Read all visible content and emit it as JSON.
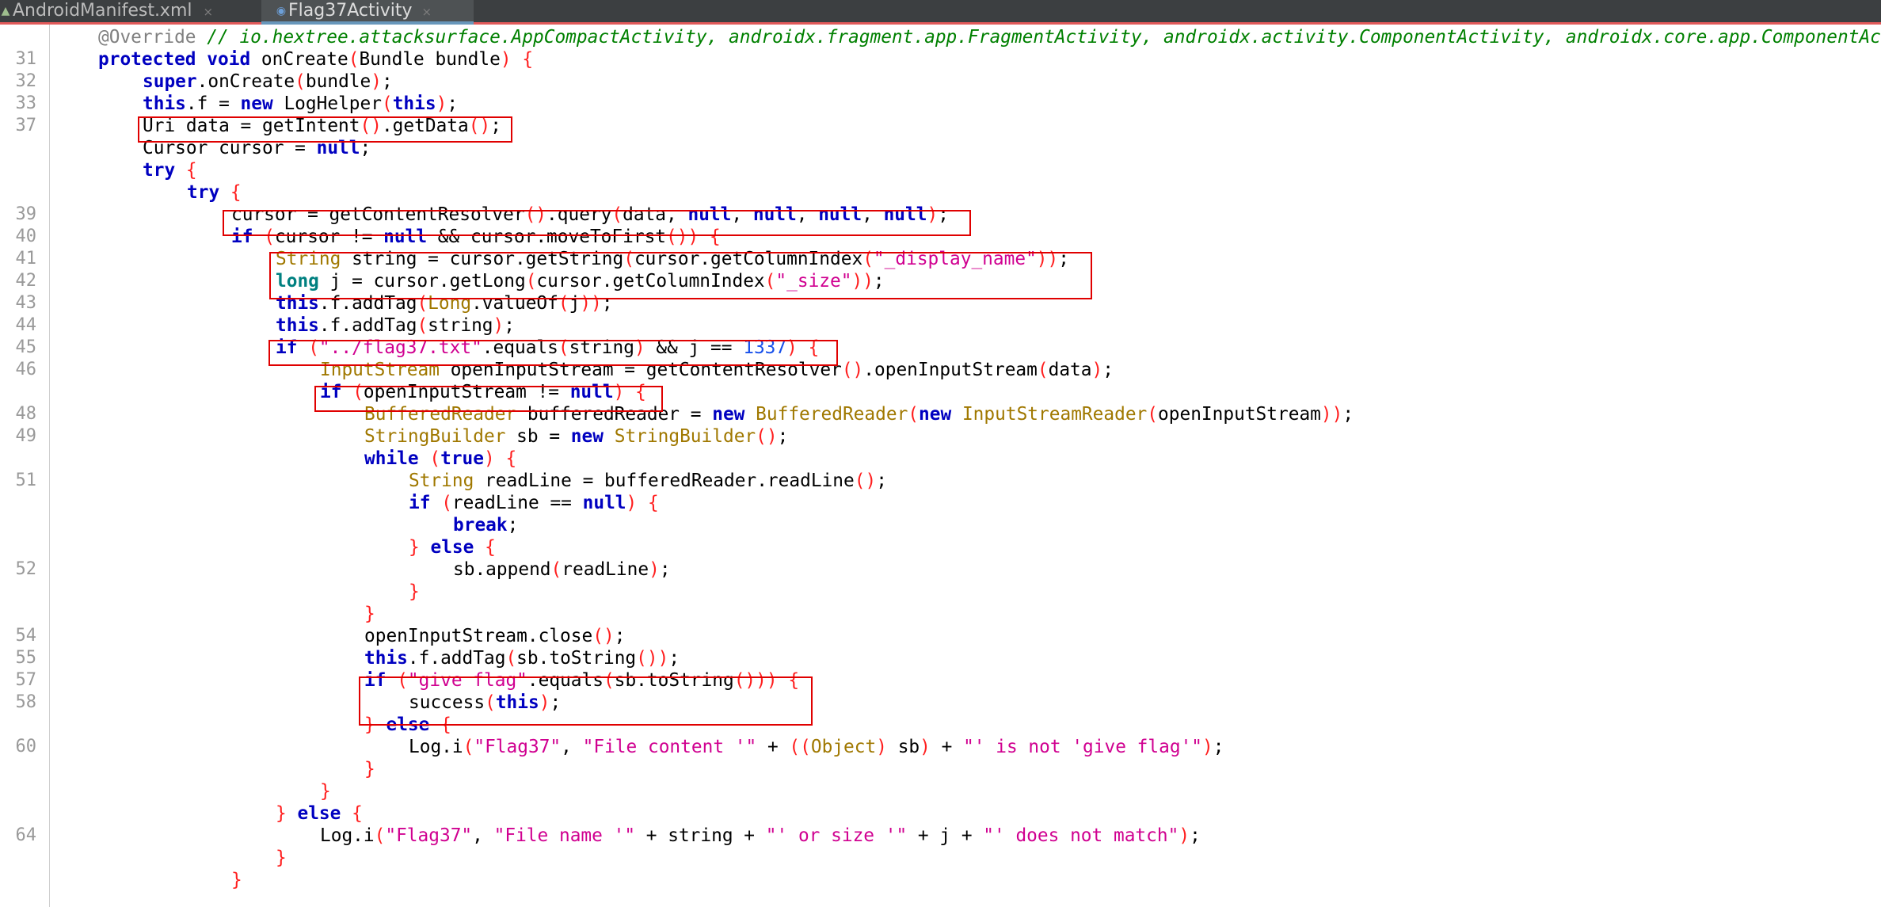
{
  "tabs": [
    {
      "label": "AndroidManifest.xml",
      "icon": "xml-file-icon",
      "close": "×"
    },
    {
      "label": "Flag37Activity",
      "icon": "class-file-icon",
      "close": "×"
    }
  ],
  "gutter": {
    "line_numbers": [
      "",
      "31",
      "32",
      "33",
      "37",
      "",
      "",
      "",
      "39",
      "40",
      "41",
      "42",
      "43",
      "44",
      "45",
      "46",
      "",
      "48",
      "49",
      "",
      "51",
      "",
      "",
      "",
      "52",
      "",
      "",
      "54",
      "55",
      "57",
      "58",
      "",
      "60",
      "",
      "",
      "",
      "64",
      "",
      ""
    ]
  },
  "code_lines": [
    [
      [
        "@Override",
        "ann"
      ],
      [
        " ",
        ""
      ],
      [
        "// io.hextree.attacksurface.AppCompactActivity, androidx.fragment.app.FragmentActivity, androidx.activity.ComponentActivity, androidx.core.app.ComponentActivity",
        "cmt"
      ]
    ],
    [
      [
        "protected",
        "kw"
      ],
      [
        " ",
        ""
      ],
      [
        "void",
        "kw"
      ],
      [
        " onCreate",
        ""
      ],
      [
        "(",
        "pl"
      ],
      [
        "Bundle bundle",
        ""
      ],
      [
        ")",
        "pl"
      ],
      [
        " ",
        ""
      ],
      [
        "{",
        "pl"
      ]
    ],
    [
      [
        "super",
        "kw"
      ],
      [
        ".onCreate",
        ""
      ],
      [
        "(",
        "pl"
      ],
      [
        "bundle",
        ""
      ],
      [
        ")",
        "pl"
      ],
      [
        ";",
        ""
      ]
    ],
    [
      [
        "this",
        "kw"
      ],
      [
        ".f = ",
        ""
      ],
      [
        "new",
        "kw"
      ],
      [
        " LogHelper",
        ""
      ],
      [
        "(",
        "pl"
      ],
      [
        "this",
        "kw"
      ],
      [
        ")",
        "pl"
      ],
      [
        ";",
        ""
      ]
    ],
    [
      [
        "Uri data = getIntent",
        ""
      ],
      [
        "()",
        "pl"
      ],
      [
        ".getData",
        ""
      ],
      [
        "()",
        "pl"
      ],
      [
        ";",
        ""
      ]
    ],
    [
      [
        "Cursor cursor = ",
        ""
      ],
      [
        "null",
        "kw"
      ],
      [
        ";",
        ""
      ]
    ],
    [
      [
        "try",
        "kw"
      ],
      [
        " ",
        ""
      ],
      [
        "{",
        "pl"
      ]
    ],
    [
      [
        "try",
        "kw"
      ],
      [
        " ",
        ""
      ],
      [
        "{",
        "pl"
      ]
    ],
    [
      [
        "cursor = getContentResolver",
        ""
      ],
      [
        "()",
        "pl"
      ],
      [
        ".query",
        ""
      ],
      [
        "(",
        "pl"
      ],
      [
        "data, ",
        ""
      ],
      [
        "null",
        "kw"
      ],
      [
        ", ",
        ""
      ],
      [
        "null",
        "kw"
      ],
      [
        ", ",
        ""
      ],
      [
        "null",
        "kw"
      ],
      [
        ", ",
        ""
      ],
      [
        "null",
        "kw"
      ],
      [
        ")",
        "pl"
      ],
      [
        ";",
        ""
      ]
    ],
    [
      [
        "if",
        "kw"
      ],
      [
        " ",
        ""
      ],
      [
        "(",
        "pl"
      ],
      [
        "cursor != ",
        ""
      ],
      [
        "null",
        "kw"
      ],
      [
        " && cursor.moveToFirst",
        ""
      ],
      [
        "()",
        "pl"
      ],
      [
        ")",
        "pl"
      ],
      [
        " ",
        ""
      ],
      [
        "{",
        "pl"
      ]
    ],
    [
      [
        "String",
        "type"
      ],
      [
        " string = cursor.getString",
        ""
      ],
      [
        "(",
        "pl"
      ],
      [
        "cursor.getColumnIndex",
        ""
      ],
      [
        "(",
        "pl"
      ],
      [
        "\"_display_name\"",
        "str"
      ],
      [
        "))",
        "pl"
      ],
      [
        ";",
        ""
      ]
    ],
    [
      [
        "long",
        "tl"
      ],
      [
        " j = cursor.getLong",
        ""
      ],
      [
        "(",
        "pl"
      ],
      [
        "cursor.getColumnIndex",
        ""
      ],
      [
        "(",
        "pl"
      ],
      [
        "\"_size\"",
        "str"
      ],
      [
        "))",
        "pl"
      ],
      [
        ";",
        ""
      ]
    ],
    [
      [
        "this",
        "kw"
      ],
      [
        ".f.addTag",
        ""
      ],
      [
        "(",
        "pl"
      ],
      [
        "Long",
        "type"
      ],
      [
        ".valueOf",
        ""
      ],
      [
        "(",
        "pl"
      ],
      [
        "j",
        ""
      ],
      [
        "))",
        "pl"
      ],
      [
        ";",
        ""
      ]
    ],
    [
      [
        "this",
        "kw"
      ],
      [
        ".f.addTag",
        ""
      ],
      [
        "(",
        "pl"
      ],
      [
        "string",
        ""
      ],
      [
        ")",
        "pl"
      ],
      [
        ";",
        ""
      ]
    ],
    [
      [
        "if",
        "kw"
      ],
      [
        " ",
        ""
      ],
      [
        "(",
        "pl"
      ],
      [
        "\"../flag37.txt\"",
        "str"
      ],
      [
        ".equals",
        ""
      ],
      [
        "(",
        "pl"
      ],
      [
        "string",
        ""
      ],
      [
        ")",
        "pl"
      ],
      [
        " && j == ",
        ""
      ],
      [
        "1337",
        "num"
      ],
      [
        ")",
        "pl"
      ],
      [
        " ",
        ""
      ],
      [
        "{",
        "pl"
      ]
    ],
    [
      [
        "InputStream",
        "type"
      ],
      [
        " openInputStream = getContentResolver",
        ""
      ],
      [
        "()",
        "pl"
      ],
      [
        ".openInputStream",
        ""
      ],
      [
        "(",
        "pl"
      ],
      [
        "data",
        ""
      ],
      [
        ")",
        "pl"
      ],
      [
        ";",
        ""
      ]
    ],
    [
      [
        "if",
        "kw"
      ],
      [
        " ",
        ""
      ],
      [
        "(",
        "pl"
      ],
      [
        "openInputStream != ",
        ""
      ],
      [
        "null",
        "kw"
      ],
      [
        ")",
        "pl"
      ],
      [
        " ",
        ""
      ],
      [
        "{",
        "pl"
      ]
    ],
    [
      [
        "BufferedReader",
        "type"
      ],
      [
        " bufferedReader = ",
        ""
      ],
      [
        "new",
        "kw"
      ],
      [
        " ",
        ""
      ],
      [
        "BufferedReader",
        "type"
      ],
      [
        "(",
        "pl"
      ],
      [
        "new",
        "kw"
      ],
      [
        " ",
        ""
      ],
      [
        "InputStreamReader",
        "type"
      ],
      [
        "(",
        "pl"
      ],
      [
        "openInputStream",
        ""
      ],
      [
        "))",
        "pl"
      ],
      [
        ";",
        ""
      ]
    ],
    [
      [
        "StringBuilder",
        "type"
      ],
      [
        " sb = ",
        ""
      ],
      [
        "new",
        "kw"
      ],
      [
        " ",
        ""
      ],
      [
        "StringBuilder",
        "type"
      ],
      [
        "()",
        "pl"
      ],
      [
        ";",
        ""
      ]
    ],
    [
      [
        "while",
        "kw"
      ],
      [
        " ",
        ""
      ],
      [
        "(",
        "pl"
      ],
      [
        "true",
        "kw"
      ],
      [
        ")",
        "pl"
      ],
      [
        " ",
        ""
      ],
      [
        "{",
        "pl"
      ]
    ],
    [
      [
        "String",
        "type"
      ],
      [
        " readLine = bufferedReader.readLine",
        ""
      ],
      [
        "()",
        "pl"
      ],
      [
        ";",
        ""
      ]
    ],
    [
      [
        "if",
        "kw"
      ],
      [
        " ",
        ""
      ],
      [
        "(",
        "pl"
      ],
      [
        "readLine == ",
        ""
      ],
      [
        "null",
        "kw"
      ],
      [
        ")",
        "pl"
      ],
      [
        " ",
        ""
      ],
      [
        "{",
        "pl"
      ]
    ],
    [
      [
        "break",
        "kw"
      ],
      [
        ";",
        ""
      ]
    ],
    [
      [
        "}",
        "pl"
      ],
      [
        " ",
        ""
      ],
      [
        "else",
        "kw"
      ],
      [
        " ",
        ""
      ],
      [
        "{",
        "pl"
      ]
    ],
    [
      [
        "sb.append",
        ""
      ],
      [
        "(",
        "pl"
      ],
      [
        "readLine",
        ""
      ],
      [
        ")",
        "pl"
      ],
      [
        ";",
        ""
      ]
    ],
    [
      [
        "}",
        "pl"
      ]
    ],
    [
      [
        "}",
        "pl"
      ]
    ],
    [
      [
        "openInputStream.close",
        ""
      ],
      [
        "()",
        "pl"
      ],
      [
        ";",
        ""
      ]
    ],
    [
      [
        "this",
        "kw"
      ],
      [
        ".f.addTag",
        ""
      ],
      [
        "(",
        "pl"
      ],
      [
        "sb.toString",
        ""
      ],
      [
        "())",
        "pl"
      ],
      [
        ";",
        ""
      ]
    ],
    [
      [
        "if",
        "kw"
      ],
      [
        " ",
        ""
      ],
      [
        "(",
        "pl"
      ],
      [
        "\"give flag\"",
        "str"
      ],
      [
        ".equals",
        ""
      ],
      [
        "(",
        "pl"
      ],
      [
        "sb.toString",
        ""
      ],
      [
        "()))",
        "pl"
      ],
      [
        " ",
        ""
      ],
      [
        "{",
        "pl"
      ]
    ],
    [
      [
        "success",
        ""
      ],
      [
        "(",
        "pl"
      ],
      [
        "this",
        "kw"
      ],
      [
        ")",
        "pl"
      ],
      [
        ";",
        ""
      ]
    ],
    [
      [
        "}",
        "pl"
      ],
      [
        " ",
        ""
      ],
      [
        "else",
        "kw"
      ],
      [
        " ",
        ""
      ],
      [
        "{",
        "pl"
      ]
    ],
    [
      [
        "Log.i",
        ""
      ],
      [
        "(",
        "pl"
      ],
      [
        "\"Flag37\"",
        "str"
      ],
      [
        ", ",
        ""
      ],
      [
        "\"File content '\"",
        "str"
      ],
      [
        " + ",
        ""
      ],
      [
        "((",
        "pl"
      ],
      [
        "Object",
        "type"
      ],
      [
        ")",
        "pl"
      ],
      [
        " sb",
        ""
      ],
      [
        ")",
        "pl"
      ],
      [
        " + ",
        ""
      ],
      [
        "\"' is not 'give flag'\"",
        "str"
      ],
      [
        ")",
        "pl"
      ],
      [
        ";",
        ""
      ]
    ],
    [
      [
        "}",
        "pl"
      ]
    ],
    [
      [
        "}",
        "pl"
      ]
    ],
    [
      [
        "}",
        "pl"
      ],
      [
        " ",
        ""
      ],
      [
        "else",
        "kw"
      ],
      [
        " ",
        ""
      ],
      [
        "{",
        "pl"
      ]
    ],
    [
      [
        "Log.i",
        ""
      ],
      [
        "(",
        "pl"
      ],
      [
        "\"Flag37\"",
        "str"
      ],
      [
        ", ",
        ""
      ],
      [
        "\"File name '\"",
        "str"
      ],
      [
        " + string + ",
        ""
      ],
      [
        "\"' or size '\"",
        "str"
      ],
      [
        " + j + ",
        ""
      ],
      [
        "\"' does not match\"",
        "str"
      ],
      [
        ")",
        "pl"
      ],
      [
        ";",
        ""
      ]
    ],
    [
      [
        "}",
        "pl"
      ]
    ],
    [
      [
        "}",
        "pl"
      ]
    ]
  ],
  "colors": {
    "annotation_box": "#e00000",
    "keyword": "#0000c0",
    "string": "#d00090",
    "comment": "#008000",
    "type": "#a07800",
    "number": "#1750eb",
    "paren": "#ff1e1e"
  }
}
